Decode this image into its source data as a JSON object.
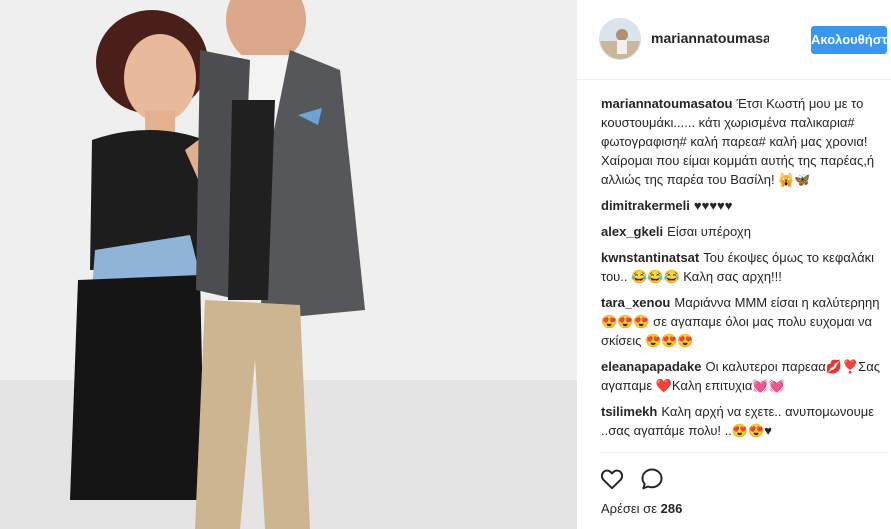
{
  "post": {
    "username": "mariannatoumasatou",
    "follow_label": "Ακολουθήστε",
    "comments": [
      {
        "user": "mariannatoumasatou",
        "text": "Έτσι Κωστή μου με το κουστουμάκι...... κάτι χωρισμένα παλικαρια# φωτογραφιση# καλή παρεα# καλή μας χρονια! Χαίρομαι που είμαι κομμάτι αυτής της παρέας,ή αλλιώς της παρέα του Βασίλη! 🙀🦋"
      },
      {
        "user": "dimitrakermeli",
        "text": "♥♥♥♥♥"
      },
      {
        "user": "alex_gkeli",
        "text": "Είσαι υπέροχη"
      },
      {
        "user": "kwnstantinatsat",
        "text": "Του έκοψες όμως το κεφαλάκι του.. 😂😂😂 Καλη σας αρχη!!!"
      },
      {
        "user": "tara_xenou",
        "text": "Μαριάννα ΜΜΜ είσαι η καλύτερηηη 😍😍😍 σε αγαπαμε όλοι μας πολυ ευχομαι να σκίσεις 😍😍😍"
      },
      {
        "user": "eleanapapadake",
        "text": "Οι καλυτεροι παρεαα💋❣️Σας αγαπαμε ❤️Καλη επιτυχια💓💓"
      },
      {
        "user": "tsilimekh",
        "text": "Καλη αρχή να εχετε.. ανυπομωνουμε ..σας αγαπάμε πολυ! ..😍😍♥"
      }
    ],
    "likes_label": "Αρέσει σε",
    "likes_count": "286"
  },
  "icons": {
    "like": "heart-outline-icon",
    "comment": "comment-bubble-icon"
  },
  "colors": {
    "follow_button": "#3897f0",
    "text": "#262626",
    "divider": "#efefef"
  }
}
